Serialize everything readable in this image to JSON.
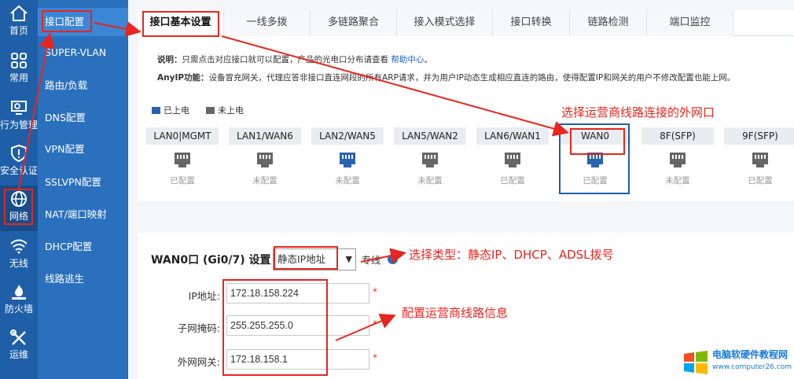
{
  "rail": {
    "items": [
      {
        "label": "首页",
        "icon": "home-icon"
      },
      {
        "label": "常用",
        "icon": "grid-icon"
      },
      {
        "label": "行为管理",
        "icon": "behavior-icon"
      },
      {
        "label": "安全认证",
        "icon": "shield-icon"
      },
      {
        "label": "网络",
        "icon": "globe-icon"
      },
      {
        "label": "无线",
        "icon": "wifi-icon"
      },
      {
        "label": "防火墙",
        "icon": "firewall-icon"
      },
      {
        "label": "运维",
        "icon": "tools-icon"
      }
    ]
  },
  "submenu": {
    "items": [
      "接口配置",
      "SUPER-VLAN",
      "路由/负载",
      "DNS配置",
      "VPN配置",
      "SSLVPN配置",
      "NAT/端口映射",
      "DHCP配置",
      "线路逃生"
    ]
  },
  "tabs": [
    "接口基本设置",
    "一线多拨",
    "多链路聚合",
    "接入模式选择",
    "接口转换",
    "链路检测",
    "端口监控"
  ],
  "notes": {
    "line1_label": "说明：",
    "line1_text": "只需点击对应接口就可以配置，产品的光电口分布请查看",
    "line1_link": "帮助中心",
    "line1_end": "。",
    "line2_label": "AnyIP功能：",
    "line2_text": "设备冒充网关，代理应答非接口直连网段的所有ARP请求，并为用户IP动态生成相应直连的路由，使得配置IP和网关的用户不修改配置也能上网。"
  },
  "legend": {
    "powered": "已上电",
    "unpowered": "未上电"
  },
  "ports": [
    {
      "name": "LAN0|MGMT",
      "status": "已配置",
      "powered": false
    },
    {
      "name": "LAN1/WAN6",
      "status": "未配置",
      "powered": false
    },
    {
      "name": "LAN2/WAN5",
      "status": "未配置",
      "powered": true
    },
    {
      "name": "LAN5/WAN2",
      "status": "未配置",
      "powered": false
    },
    {
      "name": "LAN6/WAN1",
      "status": "已配置",
      "powered": false
    },
    {
      "name": "WAN0",
      "status": "已配置",
      "powered": true
    },
    {
      "name": "8F(SFP)",
      "status": "未配置",
      "powered": false
    },
    {
      "name": "9F(SFP)",
      "status": "已配置",
      "powered": false
    }
  ],
  "form": {
    "title": "WAN0口 (Gi0/7) 设置",
    "type_value": "静态IP地址",
    "dedicated_label": "专线",
    "help": "?",
    "ip_label": "IP地址:",
    "ip_value": "172.18.158.224",
    "mask_label": "子网掩码:",
    "mask_value": "255.255.255.0",
    "gateway_label": "外网网关:",
    "gateway_value": "172.18.158.1",
    "required": "*"
  },
  "annotations": {
    "select_port": "选择运营商线路连接的外网口",
    "select_type": "选择类型：静态IP、DHCP、ADSL拨号",
    "config_info": "配置运营商线路信息"
  },
  "watermark": {
    "line1": "电脑软硬件教程网",
    "line2": "www.computer26.com"
  },
  "colors": {
    "rail": "#1f5fa8",
    "submenu": "#2a70bd",
    "accent_red": "#e8251f",
    "powered": "#2a62b0",
    "unpowered": "#666666"
  }
}
